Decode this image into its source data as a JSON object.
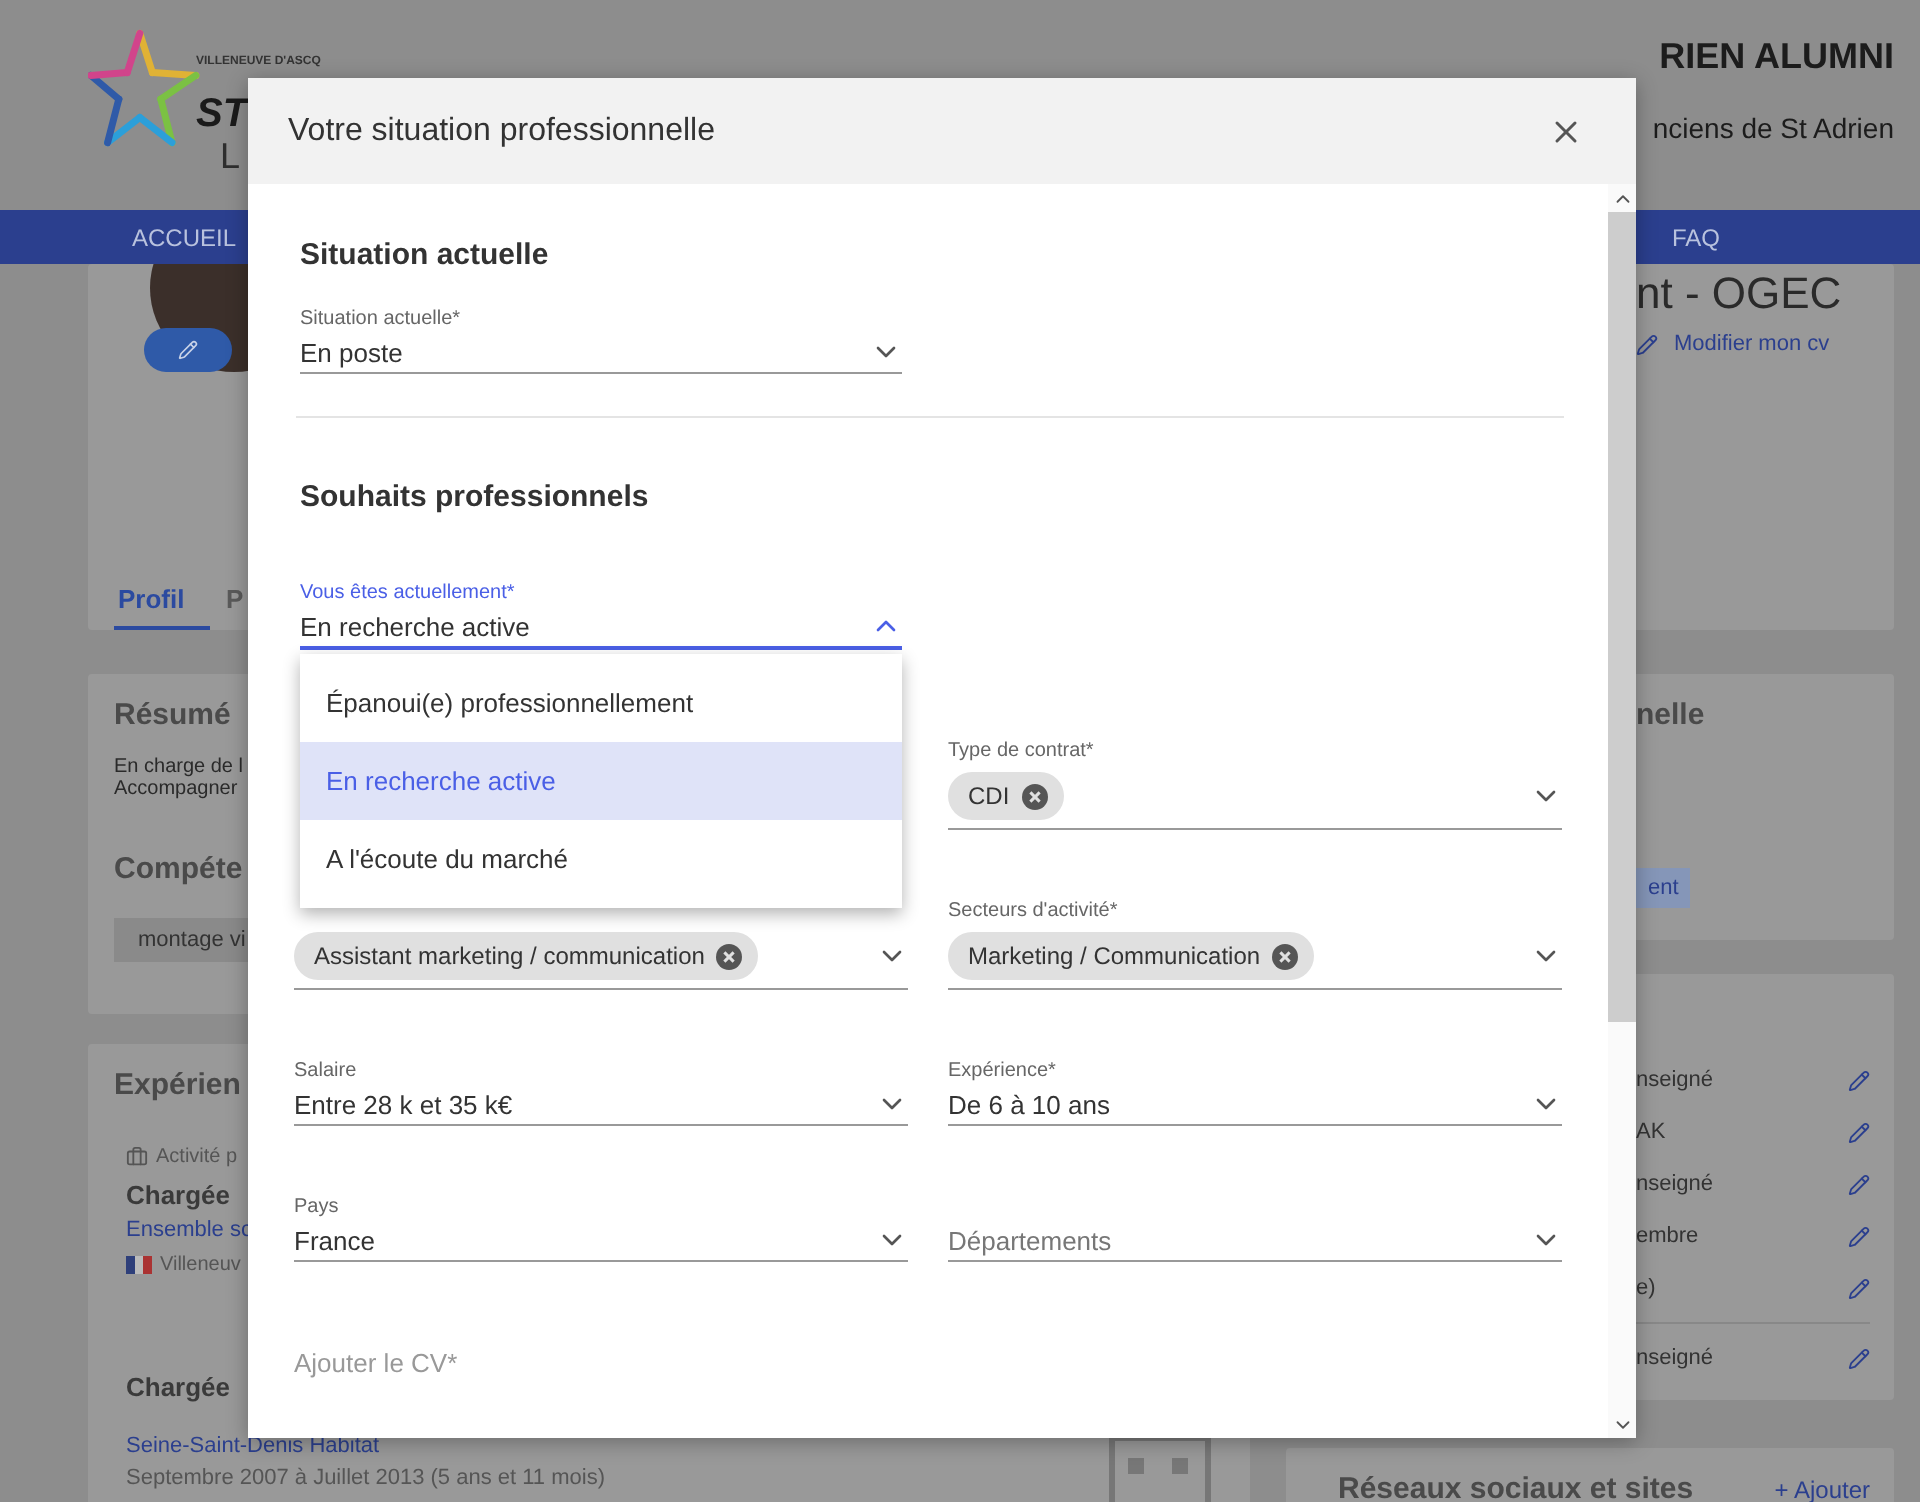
{
  "page": {
    "logo": {
      "tagline": "VILLENEUVE D'ASCQ",
      "name": "ST",
      "sub": "L"
    },
    "site_title": "RIEN ALUMNI",
    "site_subtitle": "nciens de St Adrien",
    "nav": [
      {
        "label": "ACCUEIL"
      },
      {
        "label": "FAQ"
      }
    ],
    "profile": {
      "title": "nt - OGEC",
      "edit_link": "Modifier mon cv",
      "tabs": [
        {
          "label": "Profil",
          "selected": true
        },
        {
          "label": "P",
          "selected": false
        }
      ]
    },
    "summary": {
      "heading": "Résumé",
      "lines": [
        "En charge de l",
        "Accompagner"
      ],
      "skills_heading": "Compéte",
      "skills": [
        "montage vi"
      ]
    },
    "side_card": {
      "heading": "nelle",
      "tag": "ent"
    },
    "experience": {
      "heading": "Expérien",
      "category": "Activité p",
      "items": [
        {
          "title": "Chargée",
          "company": "Ensemble sc",
          "location": "Villeneuv"
        },
        {
          "title": "Chargée",
          "company": "Seine-Saint-Denis Habitat",
          "dates": "Septembre 2007 à Juillet 2013 (5 ans et 11 mois)"
        }
      ]
    },
    "info_card": {
      "rows": [
        {
          "text": "nseigné"
        },
        {
          "text": "AK"
        },
        {
          "text": "nseigné"
        },
        {
          "text": "embre"
        },
        {
          "text": "e)"
        },
        {
          "text": "nseigné"
        }
      ]
    },
    "links_card": {
      "heading": "Réseaux sociaux et sites",
      "add": "+ Ajouter"
    }
  },
  "dialog": {
    "title": "Votre situation professionnelle",
    "current": {
      "heading": "Situation actuelle",
      "field": {
        "label": "Situation actuelle*",
        "value": "En poste",
        "expanded": false
      }
    },
    "wishes": {
      "heading": "Souhaits professionnels",
      "status_field": {
        "label": "Vous êtes actuellement*",
        "value": "En recherche active",
        "expanded": true,
        "options": [
          {
            "label": "Épanoui(e) professionnellement",
            "selected": false
          },
          {
            "label": "En recherche active",
            "selected": true
          },
          {
            "label": "A l'écoute du marché",
            "selected": false
          }
        ]
      },
      "rows": [
        {
          "right": {
            "label": "Type de contrat*",
            "chips": [
              "CDI"
            ]
          }
        },
        {
          "left": {
            "chips": [
              "Assistant marketing / communication"
            ]
          },
          "right": {
            "label": "Secteurs d'activité*",
            "chips": [
              "Marketing / Communication"
            ]
          }
        },
        {
          "left": {
            "label": "Salaire",
            "value": "Entre 28 k et 35 k€"
          },
          "right": {
            "label": "Expérience*",
            "value": "De 6 à 10 ans"
          }
        },
        {
          "left": {
            "label": "Pays",
            "value": "France"
          },
          "right": {
            "placeholder": "Départements"
          }
        }
      ],
      "cv_upload": {
        "label": "Ajouter le CV*"
      }
    }
  }
}
